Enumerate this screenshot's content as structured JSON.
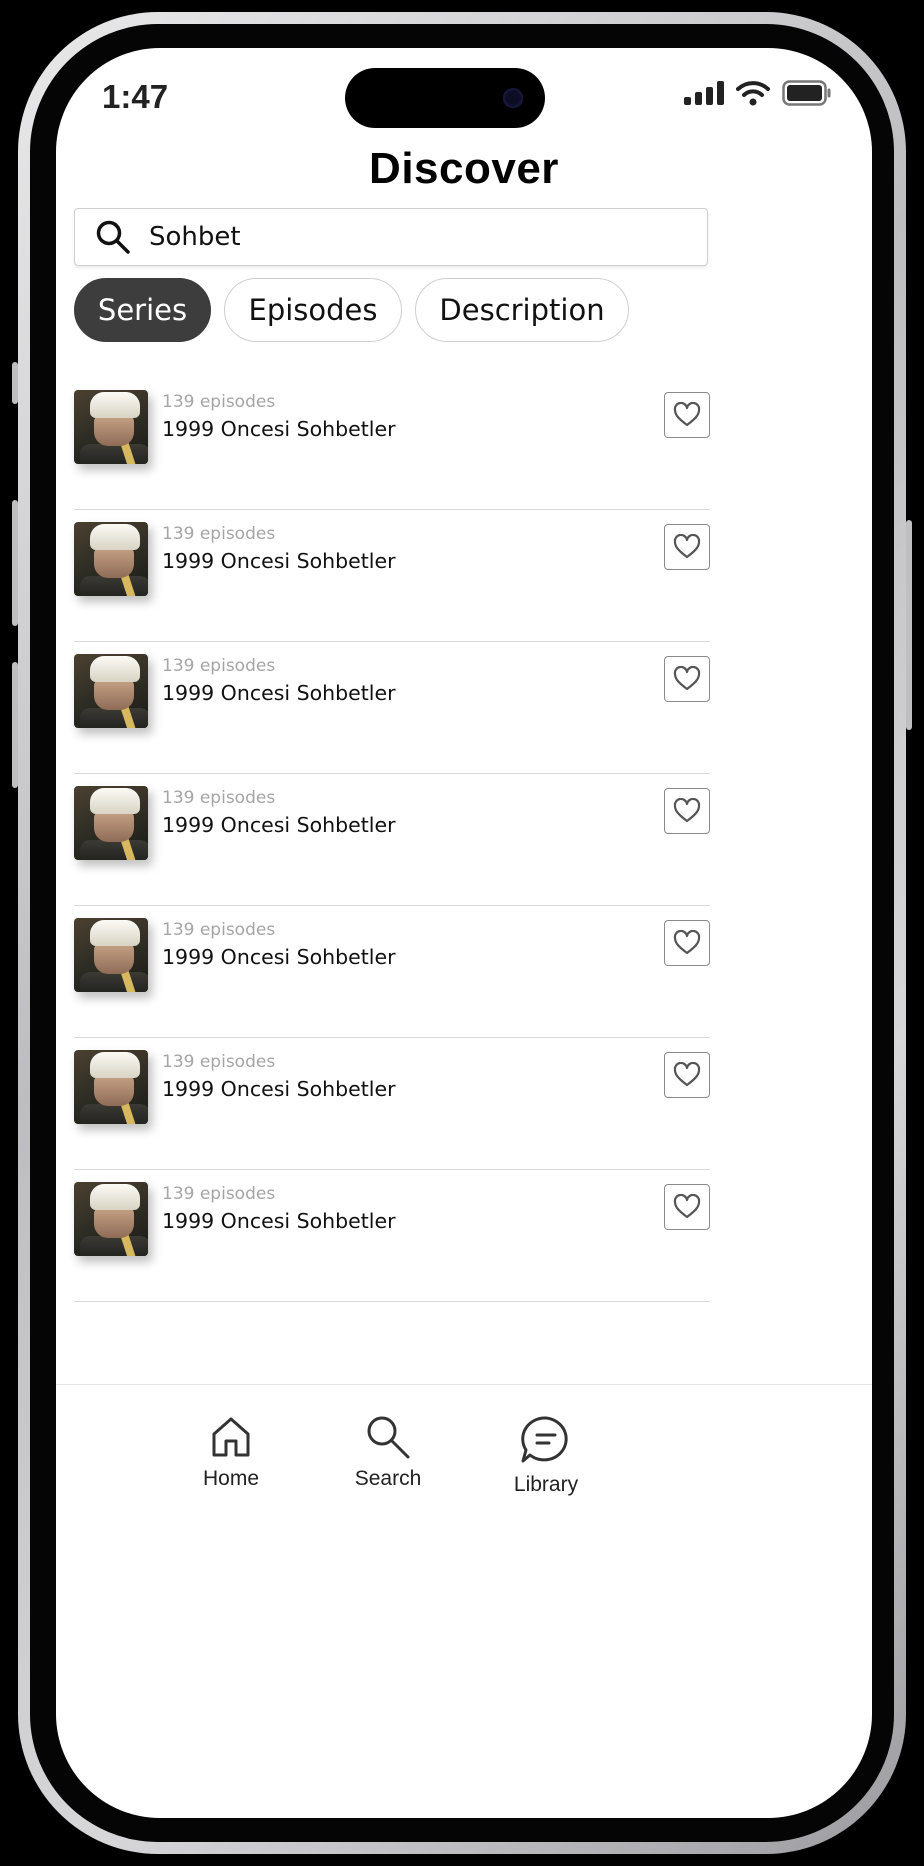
{
  "status_bar": {
    "time": "1:47"
  },
  "page": {
    "title": "Discover"
  },
  "search": {
    "value": "Sohbet",
    "placeholder": ""
  },
  "tabs": [
    {
      "label": "Series",
      "active": true
    },
    {
      "label": "Episodes",
      "active": false
    },
    {
      "label": "Description",
      "active": false
    }
  ],
  "results": [
    {
      "episodes": "139 episodes",
      "title": "1999 Oncesi Sohbetler"
    },
    {
      "episodes": "139 episodes",
      "title": "1999 Oncesi Sohbetler"
    },
    {
      "episodes": "139 episodes",
      "title": "1999 Oncesi Sohbetler"
    },
    {
      "episodes": "139 episodes",
      "title": "1999 Oncesi Sohbetler"
    },
    {
      "episodes": "139 episodes",
      "title": "1999 Oncesi Sohbetler"
    },
    {
      "episodes": "139 episodes",
      "title": "1999 Oncesi Sohbetler"
    },
    {
      "episodes": "139 episodes",
      "title": "1999 Oncesi Sohbetler"
    }
  ],
  "bottom_nav": [
    {
      "label": "Home",
      "icon": "home-icon"
    },
    {
      "label": "Search",
      "icon": "search-icon"
    },
    {
      "label": "Library",
      "icon": "chat-icon"
    }
  ],
  "colors": {
    "active_tab": "#3d3d3d",
    "secondary_text": "#a5a5a5",
    "divider": "#d9d9d9"
  }
}
